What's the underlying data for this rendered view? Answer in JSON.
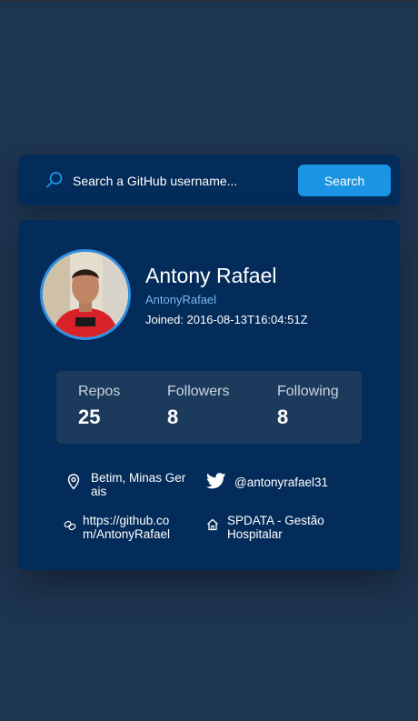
{
  "search": {
    "placeholder": "Search a GitHub username...",
    "button_label": "Search"
  },
  "profile": {
    "name": "Antony Rafael",
    "login": "AntonyRafael",
    "joined": "Joined: 2016-08-13T16:04:51Z"
  },
  "stats": {
    "repos_label": "Repos",
    "repos_value": "25",
    "followers_label": "Followers",
    "followers_value": "8",
    "following_label": "Following",
    "following_value": "8"
  },
  "info": {
    "location_line1": "Betim, Minas Ger",
    "location_line2": "ais",
    "twitter": "@antonyrafael31",
    "blog_line1": "https://github.co",
    "blog_line2": "m/AntonyRafael",
    "company_line1": "SPDATA - Gestão",
    "company_line2": "Hospitalar"
  },
  "colors": {
    "background": "#1e3550",
    "card": "#042c5a",
    "accent": "#1b94e3",
    "login": "#76b7ea",
    "stats_box": "#1c3b5c"
  },
  "icons": [
    "search-icon",
    "location-pin-icon",
    "twitter-icon",
    "link-icon",
    "building-icon"
  ]
}
